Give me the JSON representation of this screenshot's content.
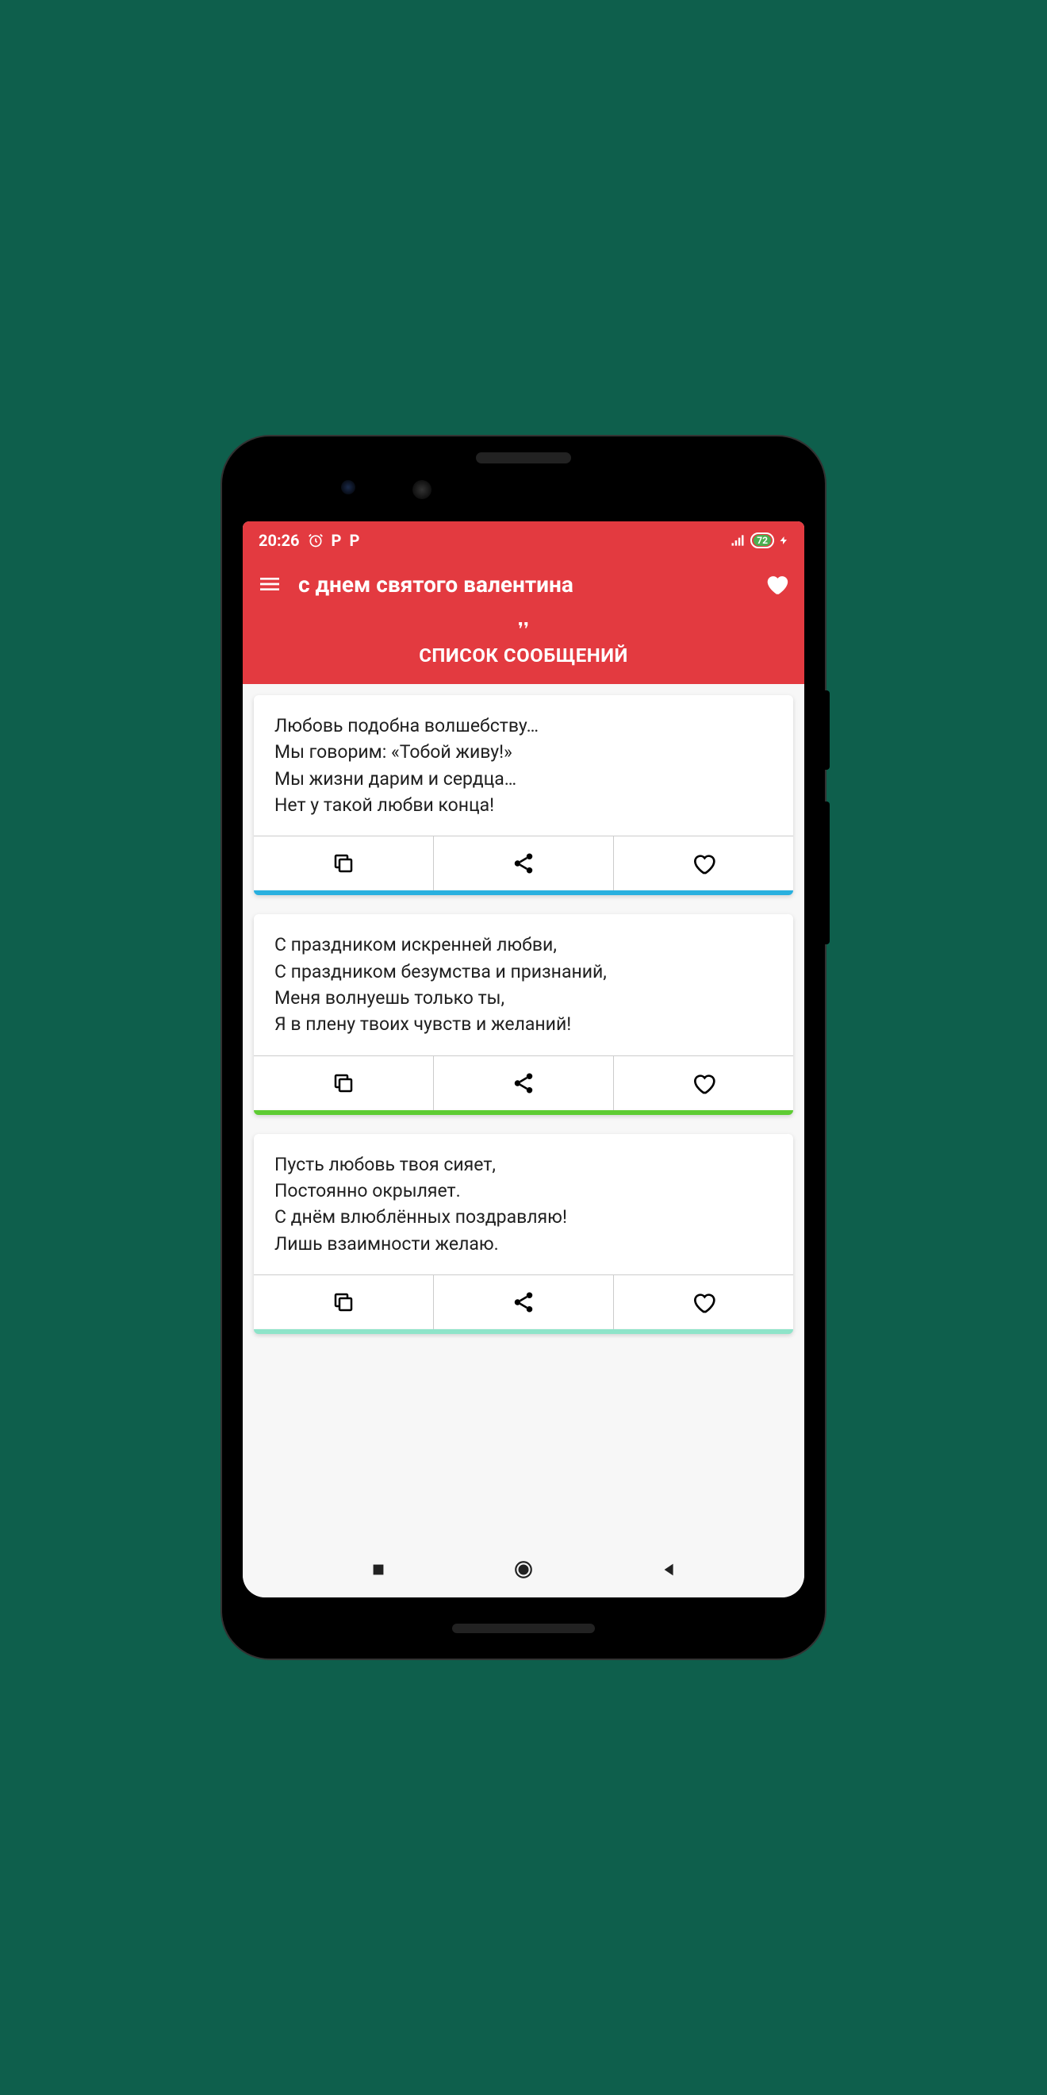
{
  "status": {
    "time": "20:26",
    "battery": "72"
  },
  "header": {
    "title": "с днем святого валентина"
  },
  "subheader": {
    "title": "СПИСОК СООБЩЕНИЙ"
  },
  "accents": [
    "#29b0df",
    "#5ecc33",
    "#8ee4c9"
  ],
  "cards": [
    {
      "text": "Любовь подобна волшебству…\nМы говорим: «Тобой живу!»\nМы жизни дарим и сердца…\nНет у такой любви конца!"
    },
    {
      "text": "С праздником искренней любви,\nС праздником безумства и признаний,\nМеня волнуешь только ты,\nЯ в плену твоих чувств и желаний!"
    },
    {
      "text": "Пусть любовь твоя сияет,\nПостоянно окрыляет.\nС днём влюблённых поздравляю!\nЛишь взаимности желаю."
    }
  ]
}
